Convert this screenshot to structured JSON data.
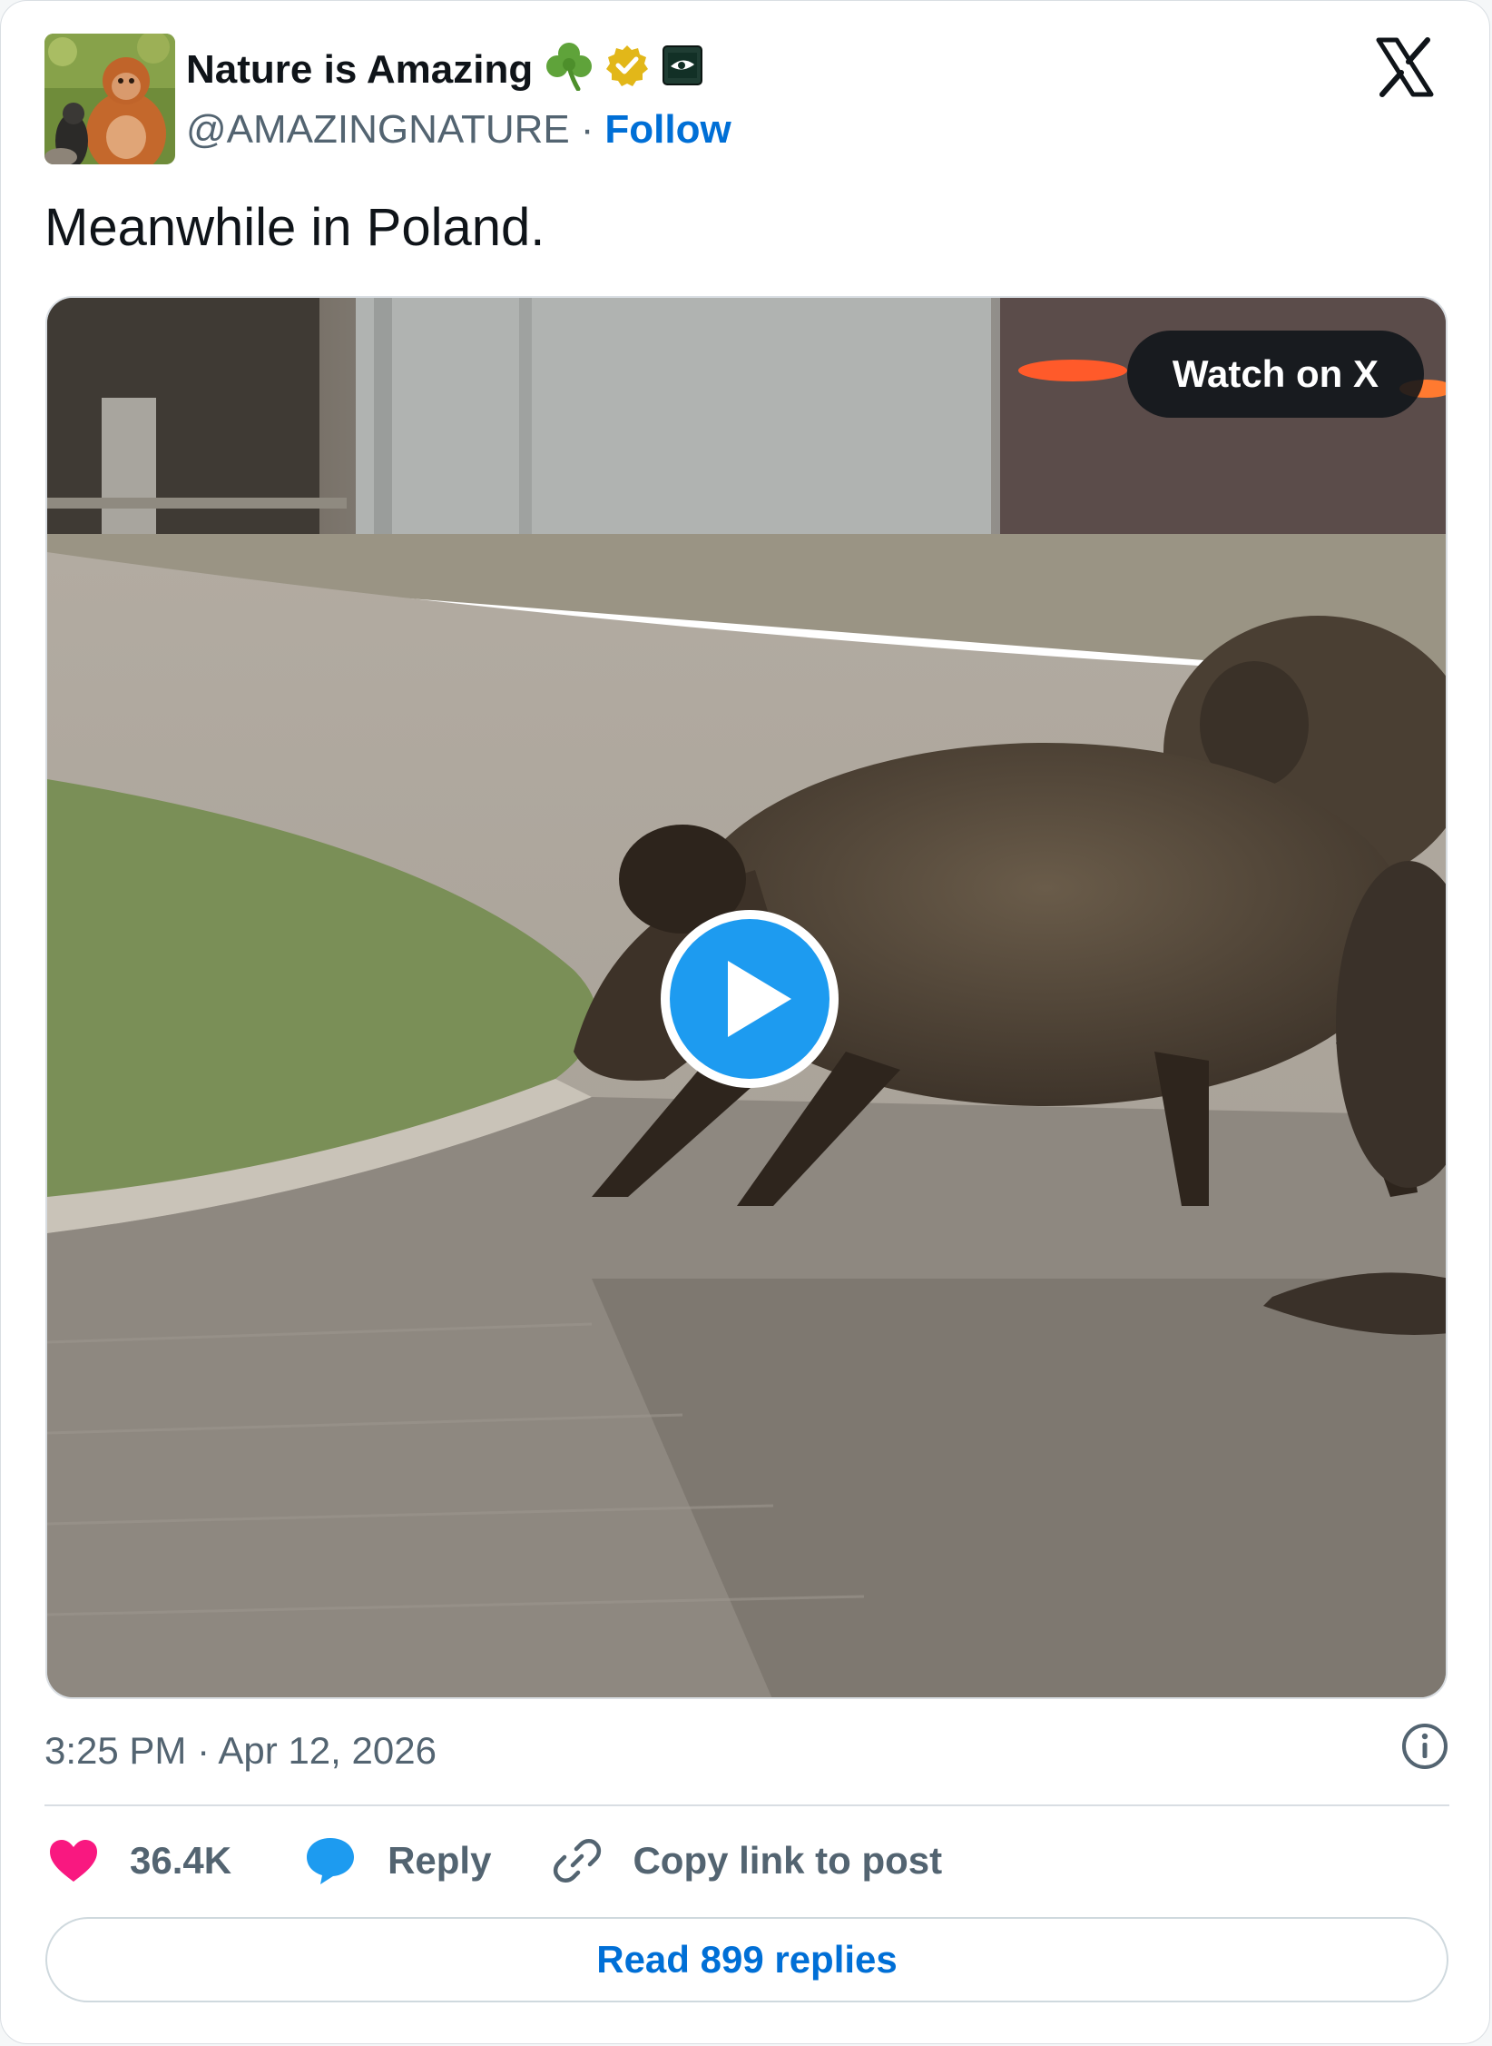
{
  "author": {
    "name": "Nature is Amazing",
    "handle": "@AMAZINGNATURE",
    "separator": "·",
    "follow_label": "Follow",
    "badge_icons": [
      "shamrock-icon",
      "verified-gold-badge-icon",
      "affiliate-badge-icon"
    ]
  },
  "post": {
    "text": "Meanwhile in Poland."
  },
  "media": {
    "watch_label": "Watch on X",
    "play_icon": "play-icon"
  },
  "meta": {
    "timestamp": "3:25 PM · Apr 12, 2026",
    "info_icon": "info-icon"
  },
  "actions": {
    "likes_count": "36.4K",
    "reply_label": "Reply",
    "copy_link_label": "Copy link to post"
  },
  "footer": {
    "read_replies_label": "Read 899 replies"
  },
  "colors": {
    "accent": "#006fd6",
    "like": "#f91880",
    "reply": "#1d9bf0",
    "secondary_text": "#536471",
    "primary_text": "#0f1419",
    "verified_gold": "#e2b719"
  }
}
